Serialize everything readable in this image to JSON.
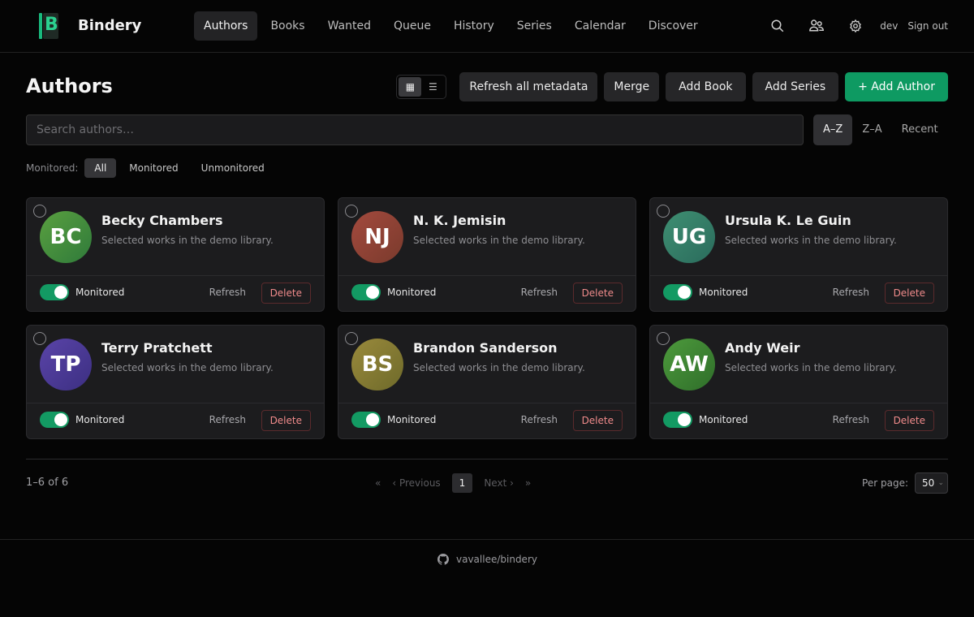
{
  "app": {
    "name": "Bindery",
    "logo_glyph": "B",
    "accent": "#0e9a62"
  },
  "nav": [
    {
      "label": "Authors",
      "active": true
    },
    {
      "label": "Books"
    },
    {
      "label": "Wanted"
    },
    {
      "label": "Queue"
    },
    {
      "label": "History"
    },
    {
      "label": "Series"
    },
    {
      "label": "Calendar"
    },
    {
      "label": "Discover"
    }
  ],
  "header": {
    "icons": [
      "search-icon",
      "users-icon",
      "gear-icon"
    ],
    "user": "dev",
    "signout_label": "Sign out"
  },
  "page": {
    "title": "Authors"
  },
  "toolbar": {
    "view_grid_icon": "▦",
    "view_list_icon": "☰",
    "refresh_all_label": "Refresh all metadata",
    "merge_label": "Merge",
    "add_book_label": "Add Book",
    "add_series_label": "Add Series",
    "add_author_label": "+ Add Author"
  },
  "search": {
    "placeholder": "Search authors…",
    "value": ""
  },
  "sort": {
    "options": [
      "A–Z",
      "Z–A",
      "Recent"
    ],
    "active": "A–Z"
  },
  "filter": {
    "label": "Monitored:",
    "options": [
      "All",
      "Monitored",
      "Unmonitored"
    ],
    "active": "All"
  },
  "authors": [
    {
      "initials": "BC",
      "name": "Becky Chambers",
      "desc": "Selected works in the demo library.",
      "monitored_label": "Monitored",
      "refresh_label": "Refresh",
      "delete_label": "Delete",
      "color_a": "#5aa040",
      "color_b": "#2f7a3a"
    },
    {
      "initials": "NJ",
      "name": "N. K. Jemisin",
      "desc": "Selected works in the demo library.",
      "monitored_label": "Monitored",
      "refresh_label": "Refresh",
      "delete_label": "Delete",
      "color_a": "#a34a3e",
      "color_b": "#7a3a2c"
    },
    {
      "initials": "UG",
      "name": "Ursula K. Le Guin",
      "desc": "Selected works in the demo library.",
      "monitored_label": "Monitored",
      "refresh_label": "Refresh",
      "delete_label": "Delete",
      "color_a": "#3f8f72",
      "color_b": "#2a6b5c"
    },
    {
      "initials": "TP",
      "name": "Terry Pratchett",
      "desc": "Selected works in the demo library.",
      "monitored_label": "Monitored",
      "refresh_label": "Refresh",
      "delete_label": "Delete",
      "color_a": "#5a44a8",
      "color_b": "#3c2f82"
    },
    {
      "initials": "BS",
      "name": "Brandon Sanderson",
      "desc": "Selected works in the demo library.",
      "monitored_label": "Monitored",
      "refresh_label": "Refresh",
      "delete_label": "Delete",
      "color_a": "#9a8a3c",
      "color_b": "#6e6a2a"
    },
    {
      "initials": "AW",
      "name": "Andy Weir",
      "desc": "Selected works in the demo library.",
      "monitored_label": "Monitored",
      "refresh_label": "Refresh",
      "delete_label": "Delete",
      "color_a": "#4d9a3c",
      "color_b": "#2f6e2a"
    }
  ],
  "pagination": {
    "count": "1–6 of 6",
    "first": "«",
    "prev": "‹ Previous",
    "current": "1",
    "next": "Next ›",
    "last": "»",
    "per_page_label": "Per page:",
    "per_page_value": "50"
  },
  "footer": {
    "repo": "vavallee/bindery"
  }
}
